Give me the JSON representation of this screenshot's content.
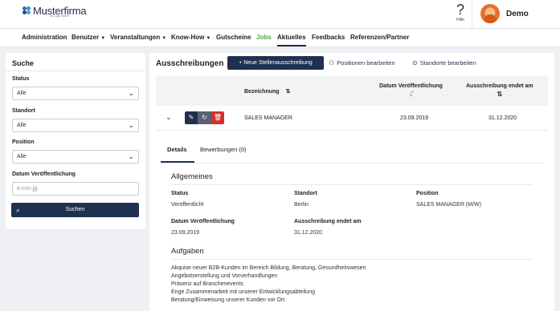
{
  "header": {
    "logo_text": "Musterfirma",
    "logo_sub": "Ihr Logo GmbH",
    "help_label": "Hilfe",
    "user_name": "Demo"
  },
  "nav": {
    "items": [
      {
        "label": "Administration"
      },
      {
        "label": "Benutzer"
      },
      {
        "label": "Veranstaltungen"
      },
      {
        "label": "Know-How"
      },
      {
        "label": "Gutscheine"
      },
      {
        "label": "Jobs"
      },
      {
        "label": "Aktuelles"
      },
      {
        "label": "Feedbacks"
      },
      {
        "label": "Referenzen/Partner"
      }
    ]
  },
  "search": {
    "title": "Suche",
    "status_label": "Status",
    "status_value": "Alle",
    "standort_label": "Standort",
    "standort_value": "Alle",
    "position_label": "Position",
    "position_value": "Alle",
    "date_label": "Datum Veröffentlichung",
    "date_placeholder": "tt.mm.jjjj",
    "button_label": "Suchen"
  },
  "main": {
    "title": "Ausschreibungen",
    "new_button": "Neue Stellenausschreibung",
    "edit_positions": "Positionen bearbeiten",
    "edit_locations": "Standorte bearbeiten",
    "columns": {
      "bezeichnung": "Bezeichnung",
      "datum": "Datum Veröffentlichung",
      "endet": "Ausschreibung endet am"
    },
    "row": {
      "bezeichnung": "SALES MANAGER",
      "datum": "23.09.2019",
      "endet": "31.12.2020"
    }
  },
  "detail": {
    "tabs": {
      "details": "Details",
      "bewerbungen": "Bewerbungen (0)"
    },
    "allgemeines_title": "Allgemeines",
    "status_label": "Status",
    "status_value": "Veröffentlicht",
    "standort_label": "Standort",
    "standort_value": "Berlin",
    "position_label": "Position",
    "position_value": "SALES MANAGER (M/W)",
    "datum_label": "Datum Veröffentlichung",
    "datum_value": "23.09.2019",
    "endet_label": "Ausschreibung endet am",
    "endet_value": "31.12.2020",
    "aufgaben_title": "Aufgaben",
    "aufgaben": [
      "Akquise neuer B2B-Kunden im Bereich Bildung, Beratung, Gesundheitswesen",
      "Angebotserstellung und Vorverhandlungen",
      "Präsenz auf Branchenevents",
      "Enge Zusammenarbeit mit unserer Entwicklungsabteilung",
      "Beratung/Einweisung unserer Kunden vor Ort"
    ]
  },
  "colors": {
    "primary": "#1f3150",
    "green_nav": "#4fa83d",
    "danger": "#d2322d"
  }
}
